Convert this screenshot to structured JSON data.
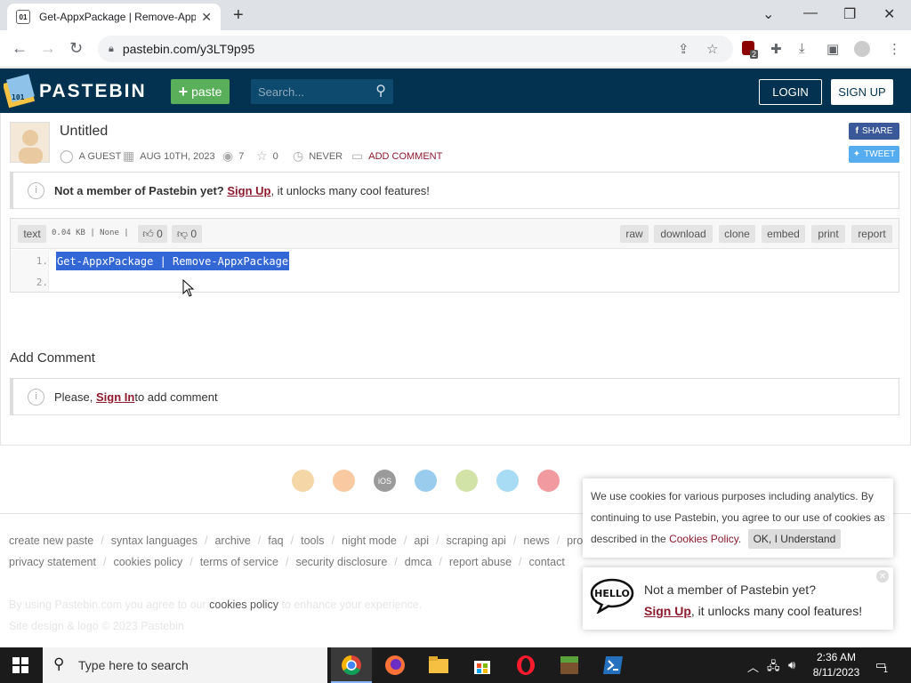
{
  "browser": {
    "tab_title": "Get-AppxPackage | Remove-App",
    "url": "pastebin.com/y3LT9p95",
    "extension_badge": "2"
  },
  "header": {
    "brand": "PASTEBIN",
    "paste_button": "paste",
    "search_placeholder": "Search...",
    "login": "LOGIN",
    "signup": "SIGN UP"
  },
  "paste": {
    "title": "Untitled",
    "author": "A GUEST",
    "date": "AUG 10TH, 2023",
    "views": "7",
    "stars": "0",
    "expiry": "NEVER",
    "add_comment_link": "ADD COMMENT",
    "share_label": "SHARE",
    "tweet_label": "TWEET"
  },
  "notice_member": {
    "lead": "Not a member of Pastebin yet?",
    "link": "Sign Up",
    "rest": ", it unlocks many cool features!"
  },
  "code": {
    "syntax": "text",
    "info": "0.04 KB | None |",
    "likes": "0",
    "dislikes": "0",
    "actions": [
      "raw",
      "download",
      "clone",
      "embed",
      "print",
      "report"
    ],
    "lines": [
      {
        "num": "1.",
        "text": "Get-AppxPackage | Remove-AppxPackage"
      },
      {
        "num": "2.",
        "text": ""
      }
    ]
  },
  "comments": {
    "heading": "Add Comment",
    "notice_pre": "Please, ",
    "notice_link": "Sign In",
    "notice_post": " to add comment"
  },
  "footer": {
    "row1": [
      "create new paste",
      "syntax languages",
      "archive",
      "faq",
      "tools",
      "night mode",
      "api",
      "scraping api",
      "news",
      "pro"
    ],
    "row2": [
      "privacy statement",
      "cookies policy",
      "terms of service",
      "security disclosure",
      "dmca",
      "report abuse",
      "contact"
    ],
    "cookie_line_pre": "By using Pastebin.com you agree to our",
    "cookie_line_link": "cookies policy",
    "cookie_line_post": "to enhance your experience.",
    "copyright": "Site design & logo © 2023 Pastebin",
    "app_icons": [
      "chrome",
      "firefox",
      "iOS",
      "windows",
      "android",
      "mac",
      "opera",
      "more"
    ]
  },
  "cookie_popup": {
    "text": "We use cookies for various purposes including analytics. By continuing to use Pastebin, you agree to our use of cookies as described in the",
    "link": "Cookies Policy",
    "button": "OK, I Understand"
  },
  "hello_popup": {
    "bubble": "HELLO",
    "line1": "Not a member of Pastebin yet?",
    "link": "Sign Up",
    "rest": ", it unlocks many cool features!"
  },
  "taskbar": {
    "search_placeholder": "Type here to search",
    "time": "2:36 AM",
    "date": "8/11/2023",
    "notif_count": "1"
  },
  "colors": {
    "header_bg": "#02324f",
    "paste_green": "#5ab05a",
    "link_red": "#8e1a2e",
    "selection_blue": "#3367d6",
    "facebook": "#3b5998",
    "twitter": "#55acee"
  }
}
